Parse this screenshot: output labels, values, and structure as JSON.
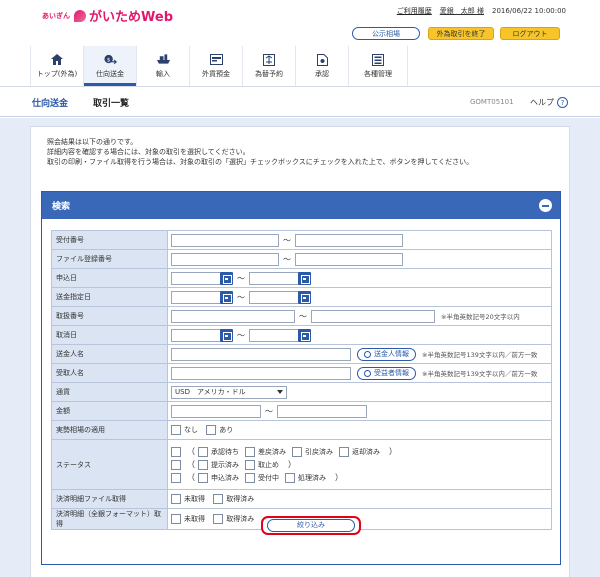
{
  "header": {
    "bank_name": "あいぎん",
    "app_name": "がいためWeb",
    "history_link": "ご利用履歴",
    "user_name": "愛銀　太郎 様",
    "datetime": "2016/06/22 10:00:00",
    "news_button": "公示相場",
    "finish_button": "外為取引を終了",
    "logout_button": "ログアウト"
  },
  "nav": {
    "items": [
      {
        "label": "トップ(外為)",
        "icon": "home-icon"
      },
      {
        "label": "仕向送金",
        "icon": "remittance-icon"
      },
      {
        "label": "輸入",
        "icon": "import-icon"
      },
      {
        "label": "外貨預金",
        "icon": "deposit-icon"
      },
      {
        "label": "為替予約",
        "icon": "forward-contract-icon"
      },
      {
        "label": "承認",
        "icon": "approval-icon"
      },
      {
        "label": "各種管理",
        "icon": "management-icon"
      }
    ]
  },
  "title": {
    "section": "仕向送金",
    "page": "取引一覧",
    "screen_id": "GOMT05101",
    "help": "ヘルプ"
  },
  "info": {
    "line1": "照会結果は以下の通りです。",
    "line2": "詳細内容を確認する場合には、対象の取引を選択してください。",
    "line3": "取引の印刷・ファイル取得を行う場合は、対象の取引の「選択」チェックボックスにチェックを入れた上で、ボタンを押してください。"
  },
  "search": {
    "title": "検索",
    "rows": {
      "receipt_no": "受付番号",
      "file_reg_no": "ファイル登録番号",
      "apply_date": "申込日",
      "remit_date": "送金指定日",
      "txn_no": "取扱番号",
      "cancel_date": "取消日",
      "sender_name": "送金人名",
      "receiver_name": "受取人名",
      "currency": "通貨",
      "amount": "金額",
      "fx_rate": "実勢相場の適用",
      "status": "ステータス",
      "settle_file": "決済明細ファイル取得",
      "settle_full": "決済明細（全銀フォーマット）取得"
    },
    "tilde": "～",
    "txn_no_note": "※半角英数記号20文字以内",
    "sender_note": "※半角英数記号139文字以内／前方一致",
    "receiver_note": "※半角英数記号139文字以内／前方一致",
    "sender_button": "送金人情報",
    "receiver_button": "受益者情報",
    "currency_value": "USD　アメリカ・ドル",
    "fx_none": "なし",
    "fx_yes": "あり",
    "status_options": {
      "awaiting_approval": "承認待ち",
      "returned": "差戻済み",
      "withdrawn": "引戻済み",
      "rejected": "返却済み",
      "submitted": "提示済み",
      "cancelled": "取止め",
      "applied": "申込済み",
      "accepted": "受付中",
      "processed": "処理済み"
    },
    "paren_open": "（",
    "paren_close": "）",
    "not_acquired": "未取得",
    "acquired": "取得済み",
    "apply_button": "絞り込み"
  }
}
